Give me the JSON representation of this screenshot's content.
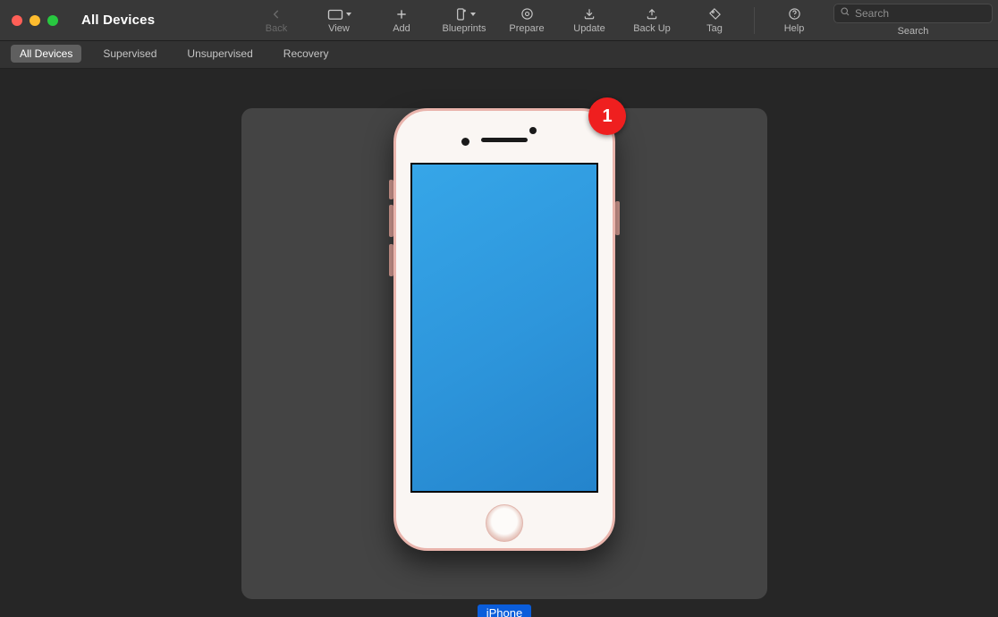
{
  "window": {
    "title": "All Devices"
  },
  "toolbar": {
    "back": {
      "label": "Back",
      "icon": "chevron-left-icon"
    },
    "view": {
      "label": "View",
      "icon": "folder-icon"
    },
    "add": {
      "label": "Add",
      "icon": "plus-icon"
    },
    "blueprints": {
      "label": "Blueprints",
      "icon": "device-plus-icon"
    },
    "prepare": {
      "label": "Prepare",
      "icon": "gear-circle-icon"
    },
    "update": {
      "label": "Update",
      "icon": "download-icon"
    },
    "backup": {
      "label": "Back Up",
      "icon": "upload-icon"
    },
    "tag": {
      "label": "Tag",
      "icon": "tag-icon"
    },
    "help": {
      "label": "Help",
      "icon": "question-circle-icon"
    },
    "search": {
      "label": "Search",
      "placeholder": "Search",
      "icon": "search-icon"
    }
  },
  "tabs": [
    {
      "label": "All Devices",
      "active": true
    },
    {
      "label": "Supervised"
    },
    {
      "label": "Unsupervised"
    },
    {
      "label": "Recovery"
    }
  ],
  "device": {
    "name": "iPhone",
    "badge_count": "1",
    "screen_color": "#2d95db",
    "body_accent": "#e9b4ac"
  }
}
